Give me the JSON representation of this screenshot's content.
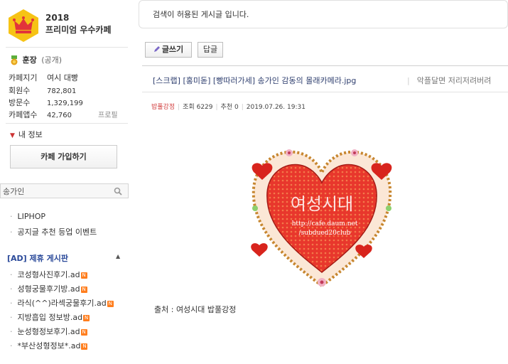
{
  "sidebar": {
    "cafe_year": "2018",
    "cafe_grade": "프리미엄 우수카페",
    "owner_label": "훈장",
    "owner_public": "(공개)",
    "info": [
      {
        "key": "카페지기",
        "value": "여시 대빵"
      },
      {
        "key": "회원수",
        "value": "782,801"
      },
      {
        "key": "방문수",
        "value": "1,329,199"
      },
      {
        "key": "카페앱수",
        "value": "42,760"
      }
    ],
    "profile_link": "프로필",
    "my_info": "내 정보",
    "join_button": "카페 가입하기",
    "search": {
      "value": "송가인",
      "icon": "search-icon"
    },
    "menu_items": [
      "LIPHOP",
      "공지글 추천 등업 이벤트"
    ],
    "ad_section_title": "[AD] 제휴 게시판",
    "ad_items": [
      "코성형사진후기.ad",
      "성형궁물후기방.ad",
      "라식(^^)라섹궁물후기.ad",
      "지방흡입 정보방.ad",
      "눈성형정보후기.ad",
      "*부산성형정보*.ad"
    ],
    "new_badge": "N"
  },
  "main": {
    "notice": "검색이 허용된 게시글 입니다.",
    "write_button": "글쓰기",
    "reply_button": "답글",
    "post_title": "[스크랩] [홍미돋] [빵따러가세] 송가인 감동의 몰래카메라.jpg",
    "post_subtitle": "악플달면 저리저려버려",
    "meta": {
      "author": "밥풀강정",
      "views": "조회 6229",
      "recommend": "추천 0",
      "date": "2019.07.26. 19:31"
    },
    "image_watermark": {
      "text": "여성시대",
      "url_line1": "http://cafe.daum.net",
      "url_line2": "/subdued20club"
    },
    "source": "출처 : 여성시대 밥풀강정"
  },
  "colors": {
    "accent_blue": "#2b4a9a",
    "author_red": "#d23f3f",
    "heart_red": "#e0322a",
    "badge_orange": "#ff7e1e"
  }
}
